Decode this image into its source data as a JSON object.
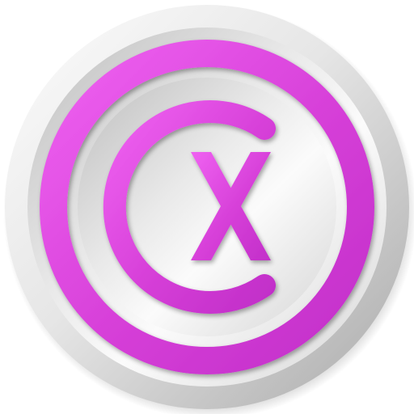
{
  "logo": {
    "monogram_text": "CX",
    "colors": {
      "background": "#ffffff",
      "accent": "#d63fd8",
      "accent_light": "#ee5cf0",
      "accent_dark": "#9f1fa6",
      "silver_light": "#fafafa",
      "silver_mid": "#d9d9d9",
      "silver_dark": "#9e9e9e"
    }
  }
}
